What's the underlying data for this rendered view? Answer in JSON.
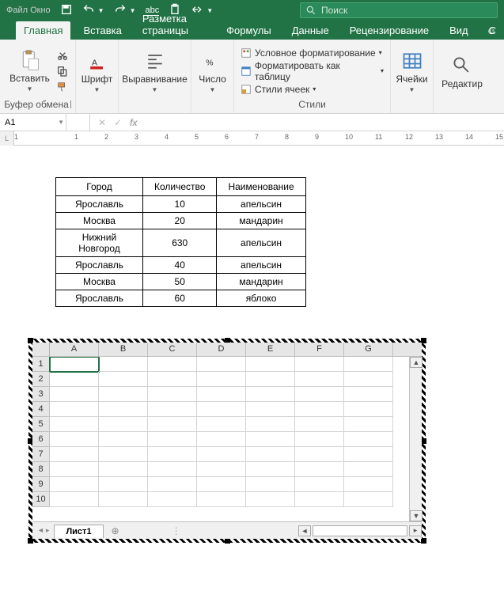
{
  "title_menu": "Файл    Окно",
  "search_placeholder": "Поиск",
  "tabs": {
    "home": "Главная",
    "insert": "Вставка",
    "page": "Разметка страницы",
    "formulas": "Формулы",
    "data": "Данные",
    "review": "Рецензирование",
    "view": "Вид"
  },
  "groups": {
    "clipboard": {
      "paste": "Вставить",
      "label": "Буфер обмена"
    },
    "font": {
      "btn": "Шрифт"
    },
    "align": {
      "btn": "Выравнивание"
    },
    "number": {
      "btn": "Число"
    },
    "styles": {
      "cond": "Условное форматирование",
      "astable": "Форматировать как таблицу",
      "cell": "Стили ячеек",
      "label": "Стили"
    },
    "cells": {
      "btn": "Ячейки"
    },
    "editing": {
      "btn": "Редактир"
    }
  },
  "name_box": "A1",
  "word_table": {
    "headers": [
      "Город",
      "Количество",
      "Наименование"
    ],
    "rows": [
      [
        "Ярославль",
        "10",
        "апельсин"
      ],
      [
        "Москва",
        "20",
        "мандарин"
      ],
      [
        "Нижний Новгород",
        "630",
        "апельсин"
      ],
      [
        "Ярославль",
        "40",
        "апельсин"
      ],
      [
        "Москва",
        "50",
        "мандарин"
      ],
      [
        "Ярославль",
        "60",
        "яблоко"
      ]
    ]
  },
  "excel": {
    "cols": [
      "A",
      "B",
      "C",
      "D",
      "E",
      "F",
      "G"
    ],
    "rows": [
      "1",
      "2",
      "3",
      "4",
      "5",
      "6",
      "7",
      "8",
      "9",
      "10"
    ],
    "sheet": "Лист1"
  },
  "ruler_marks": [
    "1",
    "",
    "1",
    "2",
    "3",
    "4",
    "5",
    "6",
    "7",
    "8",
    "9",
    "10",
    "11",
    "12",
    "13",
    "14",
    "15"
  ]
}
